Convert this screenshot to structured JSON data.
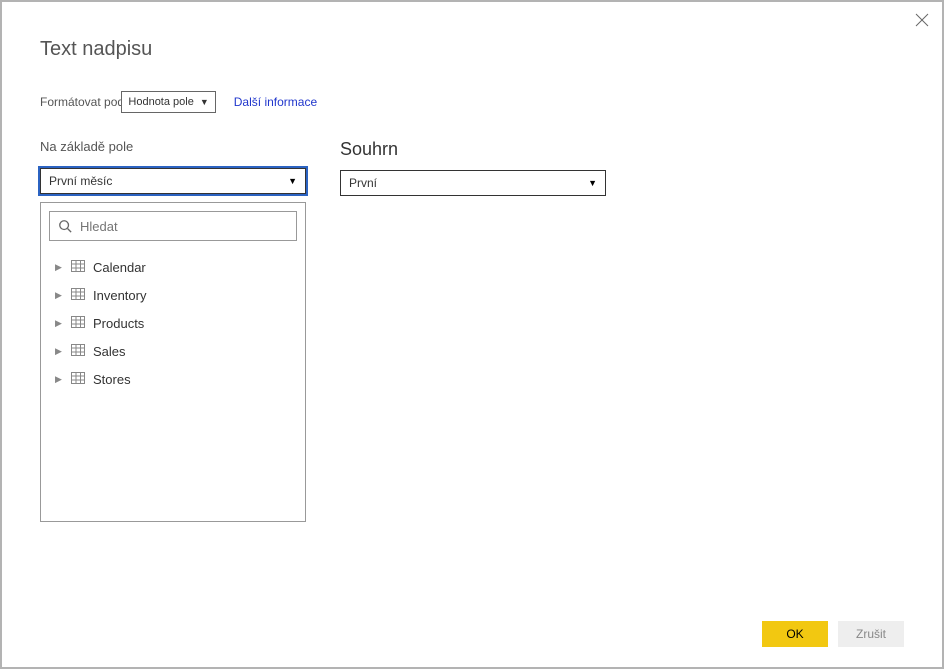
{
  "title": "Text nadpisu",
  "format_row": {
    "label": "Formátovat podle",
    "select_value": "Hodnota pole",
    "link": "Další informace"
  },
  "left": {
    "label": "Na základě pole",
    "value": "První měsíc",
    "search_placeholder": "Hledat",
    "tables": [
      "Calendar",
      "Inventory",
      "Products",
      "Sales",
      "Stores"
    ]
  },
  "right": {
    "label": "Souhrn",
    "value": "První"
  },
  "buttons": {
    "ok": "OK",
    "cancel": "Zrušit"
  }
}
